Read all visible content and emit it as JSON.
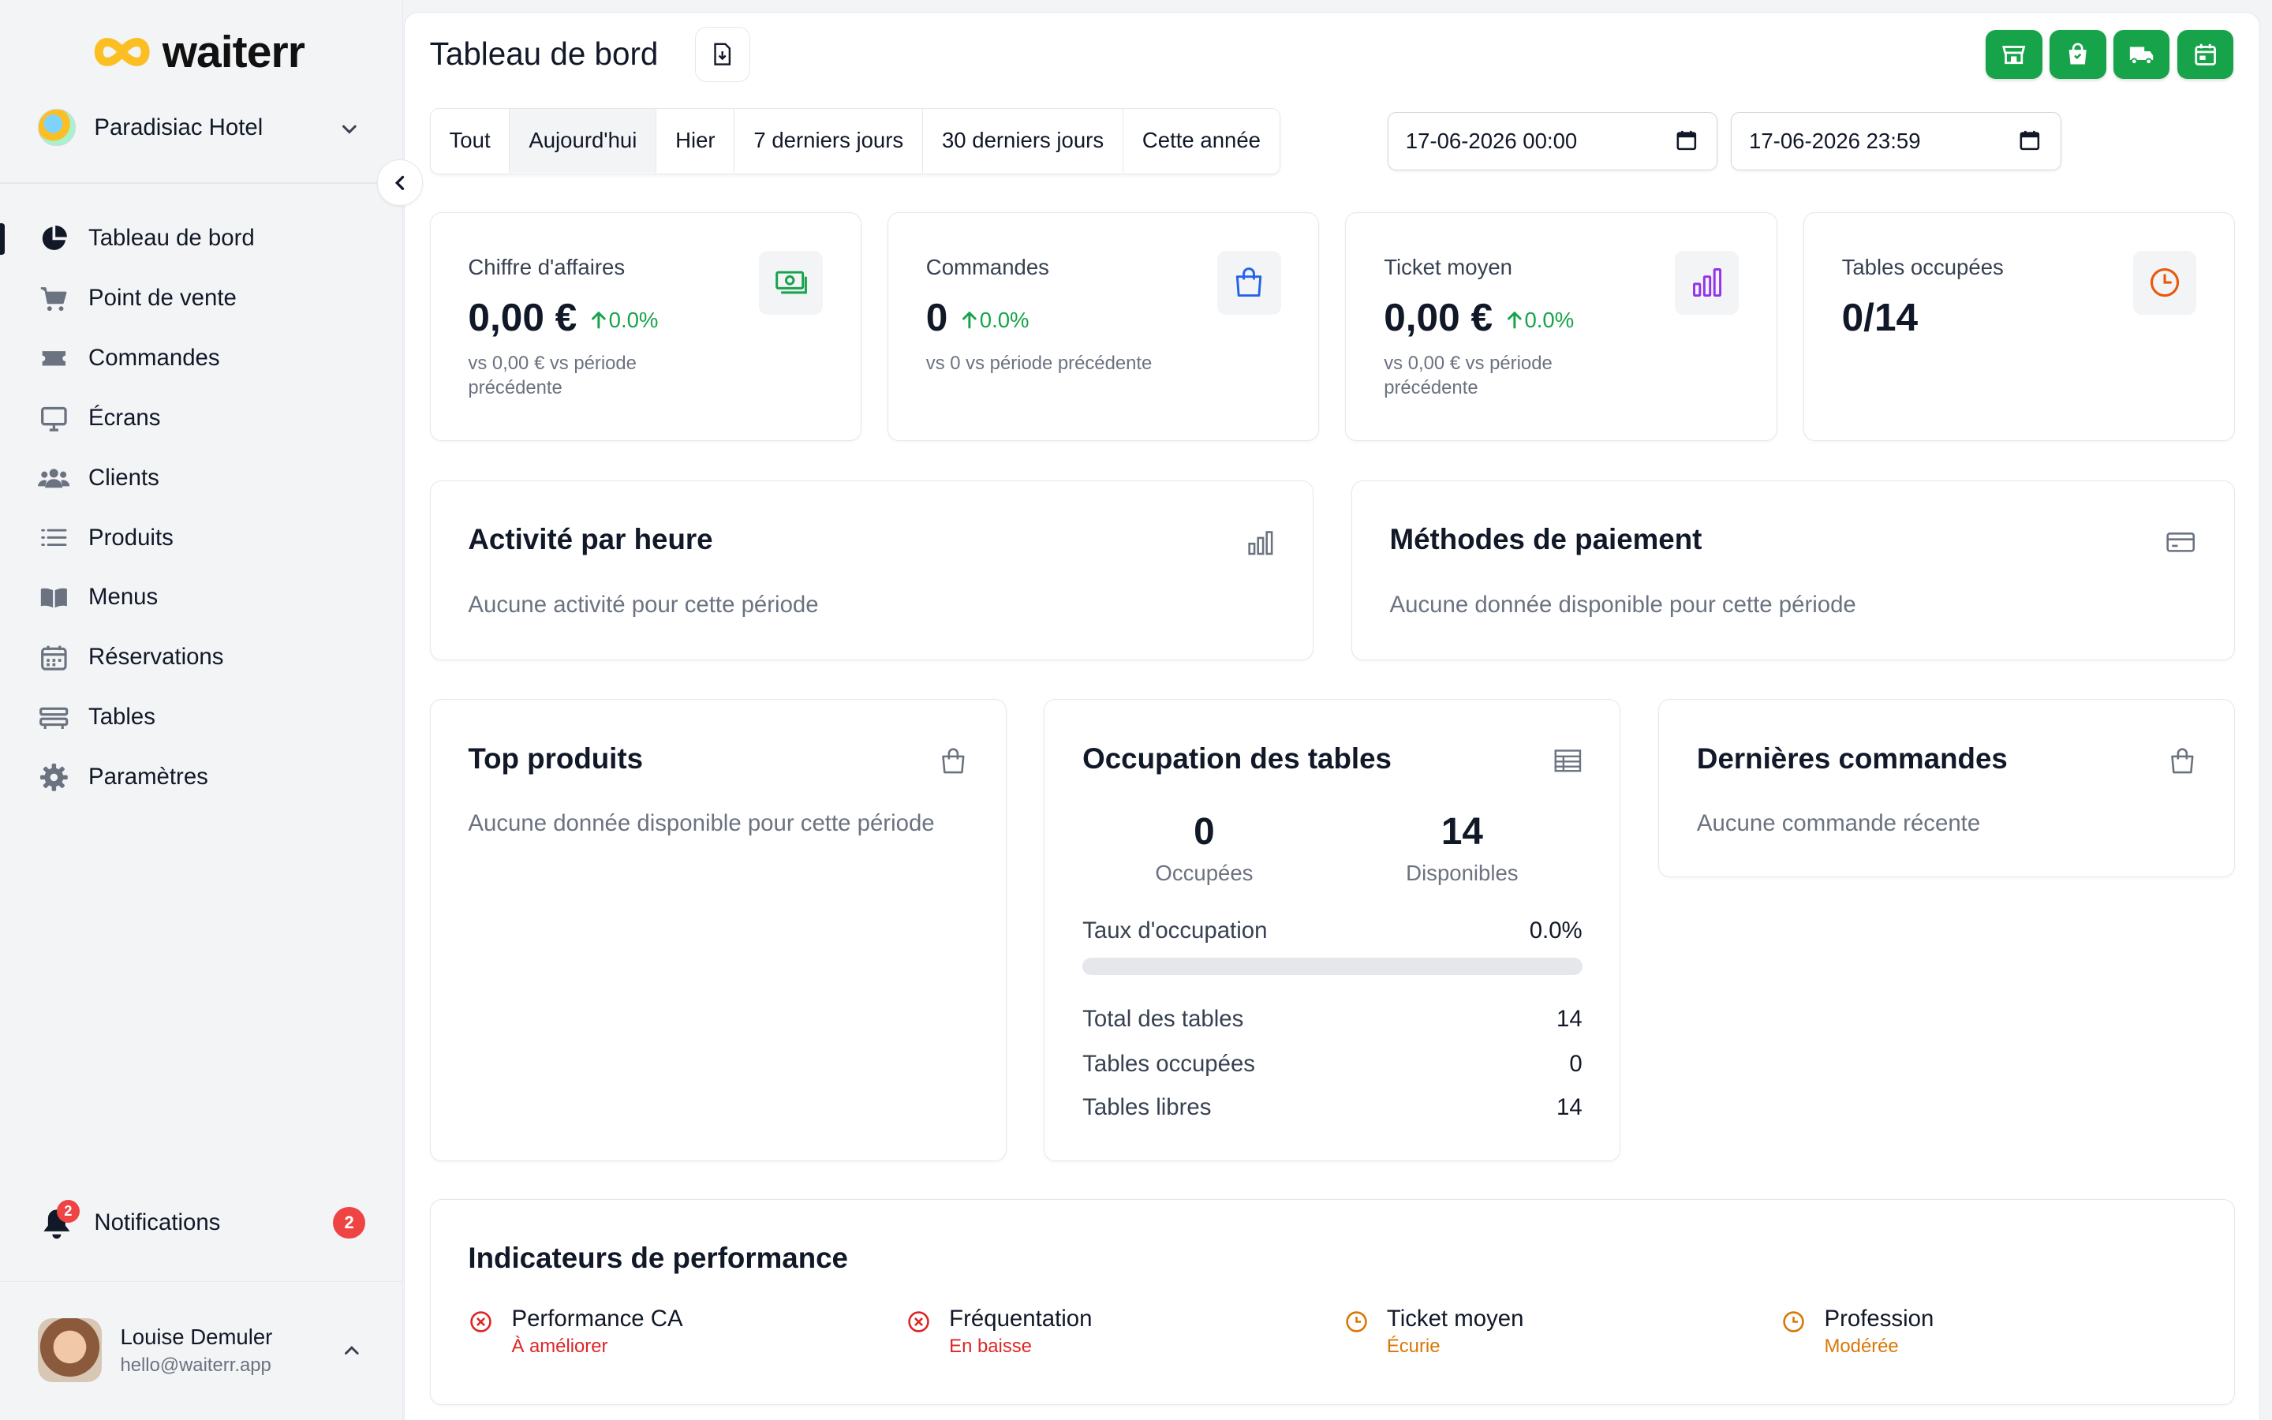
{
  "app": {
    "logo_text": "waiterr"
  },
  "hotel": {
    "name": "Paradisiac Hotel"
  },
  "sidebar": {
    "items": [
      {
        "label": "Tableau de bord",
        "icon": "pie-chart-icon",
        "active": true
      },
      {
        "label": "Point de vente",
        "icon": "cart-icon"
      },
      {
        "label": "Commandes",
        "icon": "ticket-icon"
      },
      {
        "label": "Écrans",
        "icon": "monitor-icon"
      },
      {
        "label": "Clients",
        "icon": "users-icon"
      },
      {
        "label": "Produits",
        "icon": "list-icon"
      },
      {
        "label": "Menus",
        "icon": "book-icon"
      },
      {
        "label": "Réservations",
        "icon": "calendar-icon"
      },
      {
        "label": "Tables",
        "icon": "table-icon"
      },
      {
        "label": "Paramètres",
        "icon": "gear-icon"
      }
    ],
    "notifications": {
      "label": "Notifications",
      "count": "2"
    },
    "user": {
      "name": "Louise Demuler",
      "email": "hello@waiterr.app"
    }
  },
  "header": {
    "title": "Tableau de bord",
    "quick_actions": [
      "store-icon",
      "shopping-bag-icon",
      "truck-icon",
      "calendar-icon"
    ]
  },
  "filters": {
    "ranges": [
      "Tout",
      "Aujourd'hui",
      "Hier",
      "7 derniers jours",
      "30 derniers jours",
      "Cette année"
    ],
    "selected": "Aujourd'hui",
    "start": "17-06-2026 00:00",
    "end": "17-06-2026 23:59"
  },
  "stats": [
    {
      "label": "Chiffre d'affaires",
      "value": "0,00 €",
      "trend": "0.0%",
      "compare": "vs 0,00 € vs période précédente",
      "icon": "money-icon",
      "color": "#16a34a"
    },
    {
      "label": "Commandes",
      "value": "0",
      "trend": "0.0%",
      "compare": "vs 0 vs période précédente",
      "icon": "shopping-bag-icon",
      "color": "#2563eb"
    },
    {
      "label": "Ticket moyen",
      "value": "0,00 €",
      "trend": "0.0%",
      "compare": "vs 0,00 € vs période précédente",
      "icon": "bar-chart-icon",
      "color": "#9333ea"
    },
    {
      "label": "Tables occupées",
      "value": "0/14",
      "icon": "clock-icon",
      "color": "#ea580c"
    }
  ],
  "activity": {
    "title": "Activité par heure",
    "empty": "Aucune activité pour cette période"
  },
  "payments": {
    "title": "Méthodes de paiement",
    "empty": "Aucune donnée disponible pour cette période"
  },
  "top_products": {
    "title": "Top produits",
    "empty": "Aucune donnée disponible pour cette période"
  },
  "occupancy": {
    "title": "Occupation des tables",
    "occupied": "0",
    "occupied_label": "Occupées",
    "available": "14",
    "available_label": "Disponibles",
    "rate_label": "Taux d'occupation",
    "rate": "0.0%",
    "rate_fraction": 0,
    "rows": [
      {
        "label": "Total des tables",
        "value": "14"
      },
      {
        "label": "Tables occupées",
        "value": "0"
      },
      {
        "label": "Tables libres",
        "value": "14"
      }
    ]
  },
  "recent_orders": {
    "title": "Dernières commandes",
    "empty": "Aucune commande récente"
  },
  "kpis": {
    "title": "Indicateurs de performance",
    "items": [
      {
        "name": "Performance CA",
        "status": "À améliorer",
        "color": "#dc2626",
        "icon": "x-circle-icon"
      },
      {
        "name": "Fréquentation",
        "status": "En baisse",
        "color": "#dc2626",
        "icon": "x-circle-icon"
      },
      {
        "name": "Ticket moyen",
        "status": "Écurie",
        "color": "#d97706",
        "icon": "clock-icon"
      },
      {
        "name": "Profession",
        "status": "Modérée",
        "color": "#d97706",
        "icon": "clock-icon"
      }
    ]
  }
}
